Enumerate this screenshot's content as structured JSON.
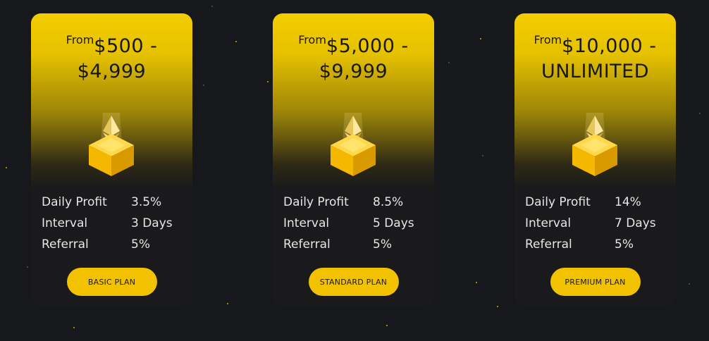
{
  "plans": [
    {
      "from_label": "From",
      "price_line1": "$500 -",
      "price_line2": "$4,999",
      "icon": "crypto-crate-icon",
      "stats": [
        {
          "label": "Daily Profit",
          "value": "3.5%"
        },
        {
          "label": "Interval",
          "value": "3 Days"
        },
        {
          "label": "Referral",
          "value": "5%"
        }
      ],
      "button_label": "BASIC PLAN"
    },
    {
      "from_label": "From",
      "price_line1": "$5,000 -",
      "price_line2": "$9,999",
      "icon": "crypto-crate-icon",
      "stats": [
        {
          "label": "Daily Profit",
          "value": "8.5%"
        },
        {
          "label": "Interval",
          "value": "5 Days"
        },
        {
          "label": "Referral",
          "value": "5%"
        }
      ],
      "button_label": "STANDARD PLAN"
    },
    {
      "from_label": "From",
      "price_line1": "$10,000 -",
      "price_line2": "UNLIMITED",
      "icon": "crypto-crate-icon",
      "stats": [
        {
          "label": "Daily Profit",
          "value": "14%"
        },
        {
          "label": "Interval",
          "value": "7 Days"
        },
        {
          "label": "Referral",
          "value": "5%"
        }
      ],
      "button_label": "PREMIUM PLAN"
    }
  ],
  "colors": {
    "background": "#17181b",
    "accent": "#f2c200",
    "card_bottom": "#1a1a1c",
    "text_dark": "#17181b",
    "text_light": "#e6e6e6"
  }
}
